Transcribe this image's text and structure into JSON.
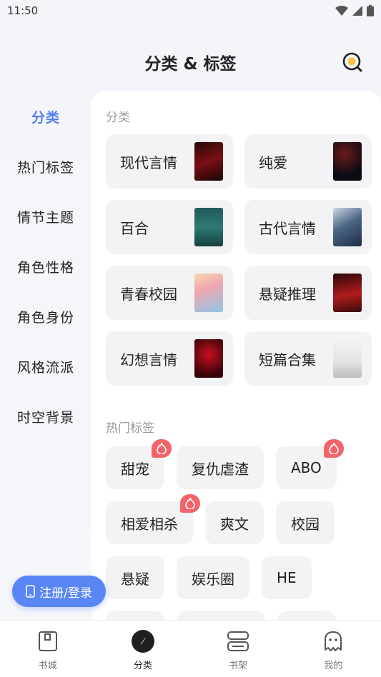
{
  "status": {
    "time": "11:50"
  },
  "header": {
    "title": "分类 & 标签"
  },
  "sidebar": {
    "items": [
      {
        "label": "分类",
        "active": true
      },
      {
        "label": "热门标签"
      },
      {
        "label": "情节主题"
      },
      {
        "label": "角色性格"
      },
      {
        "label": "角色身份"
      },
      {
        "label": "风格流派"
      },
      {
        "label": "时空背景"
      }
    ]
  },
  "categories": {
    "title": "分类",
    "items": [
      {
        "label": "现代言情",
        "cover": "dark-red"
      },
      {
        "label": "纯爱",
        "cover": "dark-night"
      },
      {
        "label": "百合",
        "cover": "teal"
      },
      {
        "label": "古代言情",
        "cover": "snow-blue"
      },
      {
        "label": "青春校园",
        "cover": "pastel"
      },
      {
        "label": "悬疑推理",
        "cover": "red-couple"
      },
      {
        "label": "幻想言情",
        "cover": "crimson"
      },
      {
        "label": "短篇合集",
        "cover": "ink-white"
      }
    ]
  },
  "hot_tags": {
    "title": "热门标签",
    "rows": [
      [
        {
          "label": "甜宠",
          "hot": true
        },
        {
          "label": "复仇虐渣"
        },
        {
          "label": "ABO",
          "hot": true
        }
      ],
      [
        {
          "label": "相爱相杀",
          "hot": true
        },
        {
          "label": "爽文"
        },
        {
          "label": "校园"
        }
      ],
      [
        {
          "label": "悬疑"
        },
        {
          "label": "娱乐圈"
        },
        {
          "label": "HE"
        }
      ]
    ]
  },
  "login_button": {
    "label": "注册/登录"
  },
  "bottom_nav": {
    "items": [
      {
        "label": "书城",
        "icon": "book-icon"
      },
      {
        "label": "分类",
        "icon": "compass-icon",
        "active": true
      },
      {
        "label": "书架",
        "icon": "bookshelf-icon"
      },
      {
        "label": "我的",
        "icon": "ghost-icon"
      }
    ]
  },
  "colors": {
    "accent": "#4f7df5",
    "hot": "#f0646a",
    "login": "#5a86f5"
  }
}
